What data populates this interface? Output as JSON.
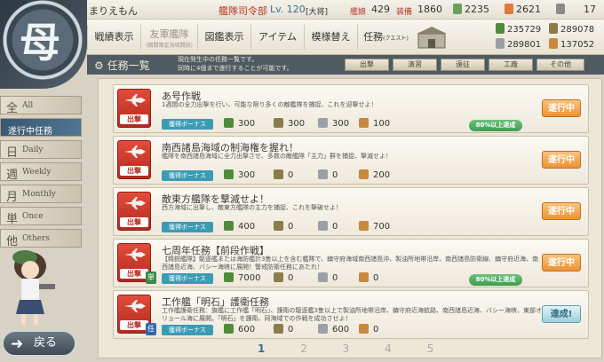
{
  "header": {
    "admiral_name": "まりえもん",
    "rank_label": "艦隊司令部",
    "level": "Lv. 120",
    "rank": "[大将]",
    "ships_label": "艦娘",
    "ships_count": "429",
    "equip_label": "装備",
    "equip_count": "1860",
    "buckets": "2235",
    "instant_build": "2621",
    "dev_material": "17"
  },
  "resources": {
    "fuel": "235729",
    "ammo": "289078",
    "steel": "289801",
    "bauxite": "137052"
  },
  "nav": [
    {
      "label": "戦績表示"
    },
    {
      "label": "友軍艦隊",
      "sub": "(期間限定海域開放)"
    },
    {
      "label": "図鑑表示"
    },
    {
      "label": "アイテム"
    },
    {
      "label": "模様替え"
    },
    {
      "label": "任務",
      "sub": "(クエスト)"
    }
  ],
  "page": {
    "title": "任務一覧",
    "desc_line1": "現在発生中の任務一覧です。",
    "desc_line2": "同時に4個まで遂行することが可能です。"
  },
  "filters": [
    "出撃",
    "演習",
    "遠征",
    "工廠",
    "その他"
  ],
  "side_tabs": [
    {
      "big": "全",
      "small": "All"
    },
    {
      "big": "",
      "small": "遂行中任務"
    },
    {
      "big": "日",
      "small": "Daily"
    },
    {
      "big": "週",
      "small": "Weekly"
    },
    {
      "big": "月",
      "small": "Monthly"
    },
    {
      "big": "単",
      "small": "Once"
    },
    {
      "big": "他",
      "small": "Others"
    }
  ],
  "back_label": "戻る",
  "quests": [
    {
      "name": "あ号作戦",
      "desc": "1週間の全力出撃を行い、可能な限り多くの敵艦隊を捕捉、これを迎撃せよ！",
      "bonus": "獲得ボーナス",
      "fuel": "300",
      "ammo": "300",
      "steel": "300",
      "bauxite": "100",
      "achieve": "80%以上達成",
      "status": "遂行中",
      "category": "出撃"
    },
    {
      "name": "南西諸島海域の制海権を握れ！",
      "desc": "艦隊を南西諸島海域に全力出撃させ、多数の敵艦隊「主力」群を捕捉、撃滅せよ！",
      "bonus": "獲得ボーナス",
      "fuel": "300",
      "ammo": "0",
      "steel": "0",
      "bauxite": "200",
      "achieve": "",
      "status": "遂行中",
      "category": "出撃"
    },
    {
      "name": "敵東方艦隊を撃滅せよ！",
      "desc": "西方海域に出撃し、敵東方艦隊の主力を捕捉、これを撃破せよ！",
      "bonus": "獲得ボーナス",
      "fuel": "400",
      "ammo": "0",
      "steel": "0",
      "bauxite": "700",
      "achieve": "",
      "status": "遂行中",
      "category": "出撃"
    },
    {
      "name": "七周年任務【前段作戦】",
      "desc": "【精鋭艦隊】駆逐艦または海防艦計3隻以上を含む艦隊で、鎮守府海域南西諸島沖、製油所地帯沿岸、南西諸島防衛線、鎮守府近海、南西諸島近海、バシー海峡に展開！警戒防衛任務にあたれ！",
      "bonus": "獲得ボーナス",
      "fuel": "7000",
      "ammo": "0",
      "steel": "0",
      "bauxite": "0",
      "achieve": "80%以上達成",
      "status": "遂行中",
      "category": "出撃",
      "flag": "単"
    },
    {
      "name": "工作艦「明石」護衛任務",
      "desc": "工作艦護衛任務：旗艦に工作艦「明石」、護衛の駆逐艦3隻以上で製油所地帯沿岸、鎮守府近海航路、南西諸島近海、バシー海峡、東部オリョール海に展開。「明石」を護衛、同海域での作戦を成功させよ！",
      "bonus": "獲得ボーナス",
      "fuel": "600",
      "ammo": "0",
      "steel": "600",
      "bauxite": "0",
      "achieve": "",
      "status": "達成!",
      "category": "出撃",
      "flag": "任"
    }
  ],
  "pager": [
    "1",
    "2",
    "3",
    "4",
    "5"
  ],
  "colors": {
    "accent": "#3a6f9a",
    "progress": "#ee9233",
    "sortie": "#c8372a",
    "bonus": "#3b9bb5"
  }
}
